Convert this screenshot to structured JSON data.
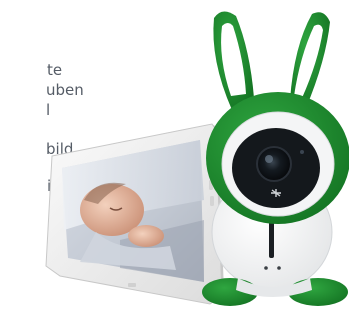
{
  "text_lines": [
    "te",
    "uben",
    "l",
    "bild",
    "ing"
  ],
  "colors": {
    "green": "#1e8c2e",
    "green_dark": "#0f6a1c",
    "text": "#555c66",
    "white": "#ffffff",
    "lens": "#111417"
  }
}
